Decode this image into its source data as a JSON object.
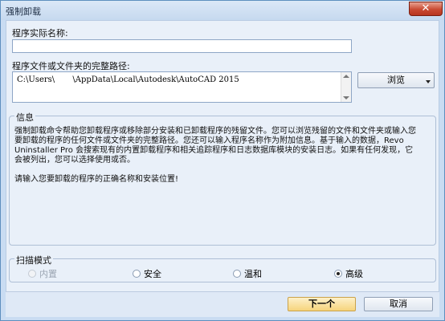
{
  "window": {
    "title": "强制卸载",
    "close_label": "✕"
  },
  "form": {
    "program_name_label": "程序实际名称:",
    "program_name_value": "",
    "path_label": "程序文件或文件夹的完整路径:",
    "path_value": "C:\\Users\\       \\AppData\\Local\\Autodesk\\AutoCAD 2015",
    "browse_label": "浏览"
  },
  "info": {
    "title": "信息",
    "paragraph1": "强制卸载命令帮助您卸载程序或移除部分安装和已卸载程序的残留文件。您可以浏览残留的文件和文件夹或输入您要卸载的程序的任何文件或文件夹的完整路径。您还可以输入程序名称作为附加信息。基于输入的数据，Revo Uninstaller Pro 会搜索现有的内置卸载程序和相关追踪程序和日志数据库模块的安装日志。如果有任何发现，它会被列出，您可以选择使用或否。",
    "paragraph2": "请输入您要卸载的程序的正确名称和安装位置!"
  },
  "scan_mode": {
    "title": "扫描模式",
    "options": [
      {
        "label": "内置",
        "checked": false,
        "disabled": true
      },
      {
        "label": "安全",
        "checked": false,
        "disabled": false
      },
      {
        "label": "温和",
        "checked": false,
        "disabled": false
      },
      {
        "label": "高级",
        "checked": true,
        "disabled": false
      }
    ]
  },
  "footer": {
    "next_label": "下一个",
    "cancel_label": "取消"
  }
}
